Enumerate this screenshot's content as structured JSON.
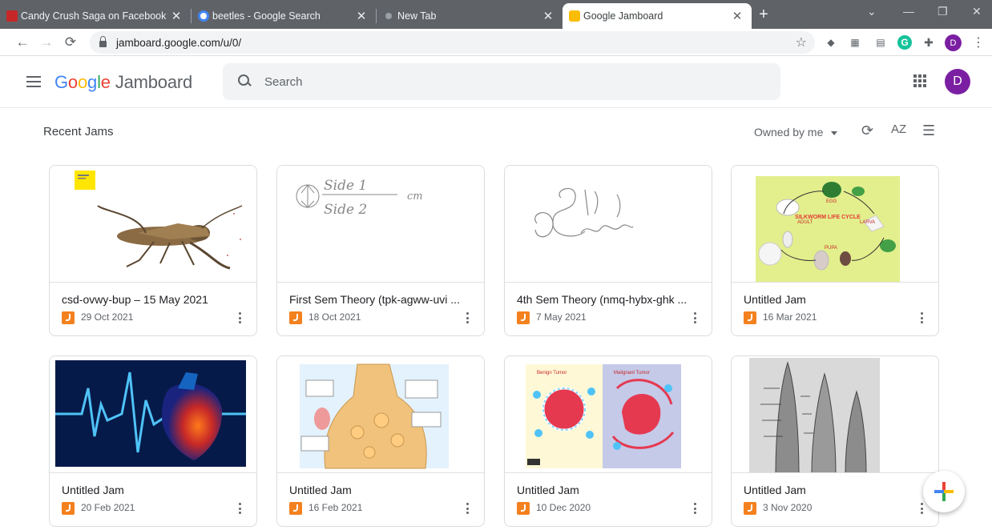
{
  "browser": {
    "tabs": [
      {
        "title": "Candy Crush Saga on Facebook",
        "favicon_color": "#c62828",
        "active": false
      },
      {
        "title": "beetles - Google Search",
        "favicon_color": "#4285f4",
        "active": false
      },
      {
        "title": "New Tab",
        "favicon_color": "#9aa0a6",
        "active": false
      },
      {
        "title": "Google Jamboard",
        "favicon_color": "#fbbc04",
        "active": true
      }
    ],
    "url": "jamboard.google.com/u/0/",
    "profile_initial": "D"
  },
  "app": {
    "logo_letters": [
      "G",
      "o",
      "o",
      "g",
      "l",
      "e"
    ],
    "product_name": "Jamboard",
    "search_placeholder": "Search",
    "user_initial": "D",
    "accent_color": "#7b1fa2"
  },
  "toolbar": {
    "section_title": "Recent Jams",
    "owner_filter": "Owned by me",
    "sort_label": "AZ"
  },
  "jams": [
    {
      "title": "csd-ovwy-bup – 15 May 2021",
      "date": "29 Oct 2021",
      "thumbnail": "grasshopper"
    },
    {
      "title": "First Sem Theory (tpk-agww-uvi ...",
      "date": "18 Oct 2021",
      "thumbnail": "sketch-sides"
    },
    {
      "title": "4th Sem Theory (nmq-hybx-ghk ...",
      "date": "7 May 2021",
      "thumbnail": "sketch-scribble"
    },
    {
      "title": "Untitled Jam",
      "date": "16 Mar 2021",
      "thumbnail": "silkworm-life-cycle"
    },
    {
      "title": "Untitled Jam",
      "date": "20 Feb 2021",
      "thumbnail": "heart-pulse"
    },
    {
      "title": "Untitled Jam",
      "date": "16 Feb 2021",
      "thumbnail": "synapse"
    },
    {
      "title": "Untitled Jam",
      "date": "10 Dec 2020",
      "thumbnail": "tumor-comparison"
    },
    {
      "title": "Untitled Jam",
      "date": "3 Nov 2020",
      "thumbnail": "plant-apex"
    }
  ],
  "thumb_text": {
    "sketch_side1": "Side 1",
    "sketch_side2": "Side 2",
    "sketch_cm": "cm",
    "silkworm_title": "SILKWORM LIFE CYCLE",
    "silkworm_adult": "ADULT",
    "silkworm_egg": "EGG",
    "silkworm_larva": "LARVA",
    "silkworm_pupa": "PUPA",
    "tumor_benign": "Benign Tumor",
    "tumor_malignant": "Malignant Tumor"
  }
}
